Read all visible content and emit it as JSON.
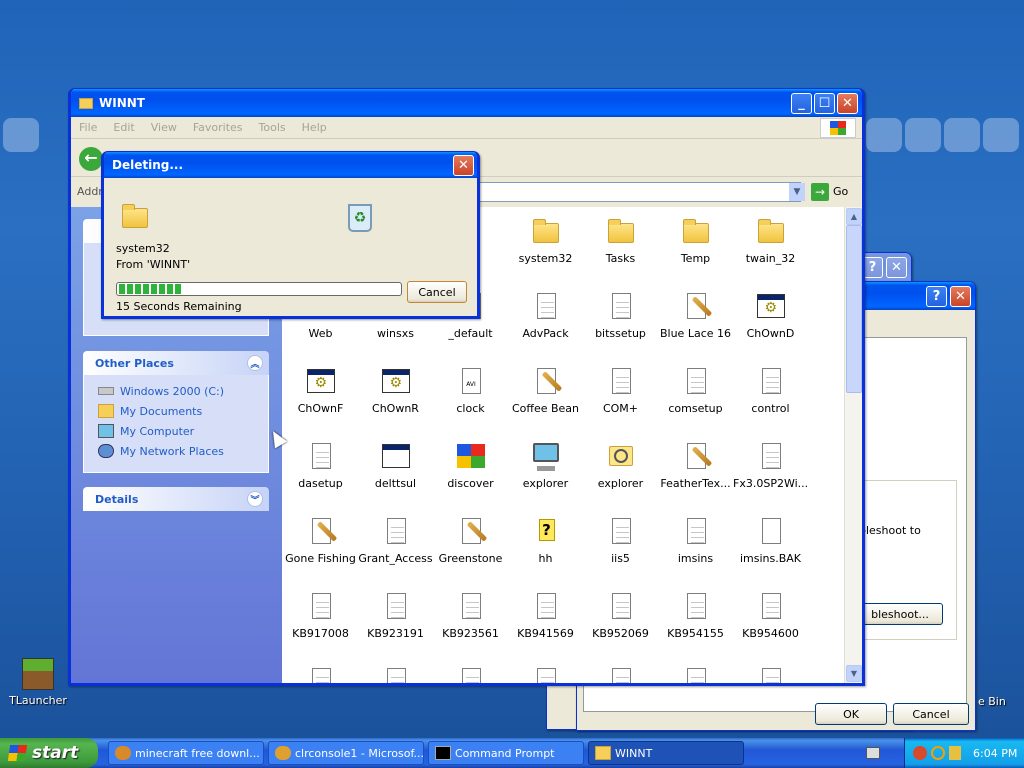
{
  "desktop": {
    "icons": [
      {
        "label": "TLauncher",
        "icon": "minecraft-grass-block-icon"
      }
    ],
    "partial_label_recycle": "e Bin"
  },
  "explorer": {
    "title": "WINNT",
    "menu": [
      "File",
      "Edit",
      "View",
      "Favorites",
      "Tools",
      "Help"
    ],
    "address_label": "Addr",
    "go_label": "Go",
    "other_places": {
      "header": "Other Places",
      "items": [
        "Windows 2000 (C:)",
        "My Documents",
        "My Computer",
        "My Network Places"
      ]
    },
    "details_header": "Details",
    "files": [
      {
        "name": "system32",
        "icon": "folder-icon"
      },
      {
        "name": "Tasks",
        "icon": "folder-icon"
      },
      {
        "name": "Temp",
        "icon": "folder-icon"
      },
      {
        "name": "twain_32",
        "icon": "folder-icon"
      },
      {
        "name": "Web",
        "icon": "folder-icon"
      },
      {
        "name": "winsxs",
        "icon": "folder-icon"
      },
      {
        "name": "_default",
        "icon": "document-icon"
      },
      {
        "name": "AdvPack",
        "icon": "document-icon"
      },
      {
        "name": "bitssetup",
        "icon": "document-icon"
      },
      {
        "name": "Blue Lace 16",
        "icon": "paint-icon"
      },
      {
        "name": "ChOwnD",
        "icon": "application-icon"
      },
      {
        "name": "ChOwnF",
        "icon": "application-icon"
      },
      {
        "name": "ChOwnR",
        "icon": "application-icon"
      },
      {
        "name": "clock",
        "icon": "avi-icon"
      },
      {
        "name": "Coffee Bean",
        "icon": "paint-icon"
      },
      {
        "name": "COM+",
        "icon": "document-icon"
      },
      {
        "name": "comsetup",
        "icon": "document-icon"
      },
      {
        "name": "control",
        "icon": "control-panel-icon"
      },
      {
        "name": "dasetup",
        "icon": "document-icon"
      },
      {
        "name": "delttsul",
        "icon": "window-icon"
      },
      {
        "name": "discover",
        "icon": "windows-logo-icon"
      },
      {
        "name": "explorer",
        "icon": "monitor-icon"
      },
      {
        "name": "explorer",
        "icon": "search-folder-icon"
      },
      {
        "name": "FeatherTex...",
        "icon": "paint-icon"
      },
      {
        "name": "Fx3.0SP2Wi...",
        "icon": "document-icon"
      },
      {
        "name": "Gone Fishing",
        "icon": "paint-icon"
      },
      {
        "name": "Grant_Access",
        "icon": "document-icon"
      },
      {
        "name": "Greenstone",
        "icon": "paint-icon"
      },
      {
        "name": "hh",
        "icon": "help-icon"
      },
      {
        "name": "iis5",
        "icon": "document-icon"
      },
      {
        "name": "imsins",
        "icon": "document-icon"
      },
      {
        "name": "imsins.BAK",
        "icon": "bak-icon"
      },
      {
        "name": "KB917008",
        "icon": "document-icon"
      },
      {
        "name": "KB923191",
        "icon": "document-icon"
      },
      {
        "name": "KB923561",
        "icon": "document-icon"
      },
      {
        "name": "KB941569",
        "icon": "document-icon"
      },
      {
        "name": "KB952069",
        "icon": "document-icon"
      },
      {
        "name": "KB954155",
        "icon": "document-icon"
      },
      {
        "name": "KB954600",
        "icon": "document-icon"
      }
    ]
  },
  "deleting_dialog": {
    "title": "Deleting...",
    "item": "system32",
    "from": "From 'WINNT'",
    "remaining": "15 Seconds Remaining",
    "progress": 0.23,
    "cancel": "Cancel"
  },
  "background_dialog": {
    "partial_text_1": "bleshoot to",
    "partial_button": "bleshoot...",
    "ok": "OK",
    "cancel": "Cancel"
  },
  "taskbar": {
    "start": "start",
    "tasks": [
      {
        "label": "minecraft free downl...",
        "icon": "browser-icon"
      },
      {
        "label": "clrconsole1 - Microsof...",
        "icon": "app-icon"
      },
      {
        "label": "Command Prompt",
        "icon": "cmd-icon"
      },
      {
        "label": "WINNT",
        "icon": "folder-icon",
        "active": true
      }
    ],
    "clock": "6:04 PM"
  }
}
